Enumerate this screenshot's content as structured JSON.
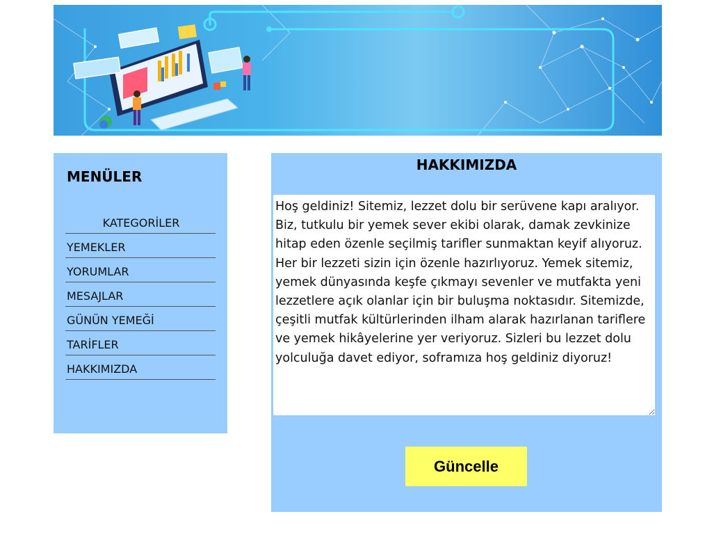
{
  "sidebar": {
    "title": "MENÜLER",
    "items": [
      {
        "label": "KATEGORİLER"
      },
      {
        "label": "YEMEKLER"
      },
      {
        "label": "YORUMLAR"
      },
      {
        "label": "MESAJLAR"
      },
      {
        "label": "GÜNÜN YEMEĞİ"
      },
      {
        "label": "TARİFLER"
      },
      {
        "label": "HAKKIMIZDA"
      }
    ]
  },
  "main": {
    "title": "HAKKIMIZDA",
    "about_text": "Hoş geldiniz! Sitemiz, lezzet dolu bir serüvene kapı aralıyor. Biz, tutkulu bir yemek sever ekibi olarak, damak zevkinize hitap eden özenle seçilmiş tarifler sunmaktan keyif alıyoruz. Her bir lezzeti sizin için özenle hazırlıyoruz. Yemek sitemiz, yemek dünyasında keşfe çıkmayı sevenler ve mutfakta yeni lezzetlere açık olanlar için bir buluşma noktasıdır. Sitemizde, çeşitli mutfak kültürlerinden ilham alarak hazırlanan tariflere ve yemek hikâyelerine yer veriyoruz. Sizleri bu lezzet dolu yolculuğa davet ediyor, soframıza hoş geldiniz diyoruz!",
    "update_label": "Güncelle"
  },
  "colors": {
    "panel_bg": "#99ccff",
    "button_bg": "#ffff66"
  }
}
